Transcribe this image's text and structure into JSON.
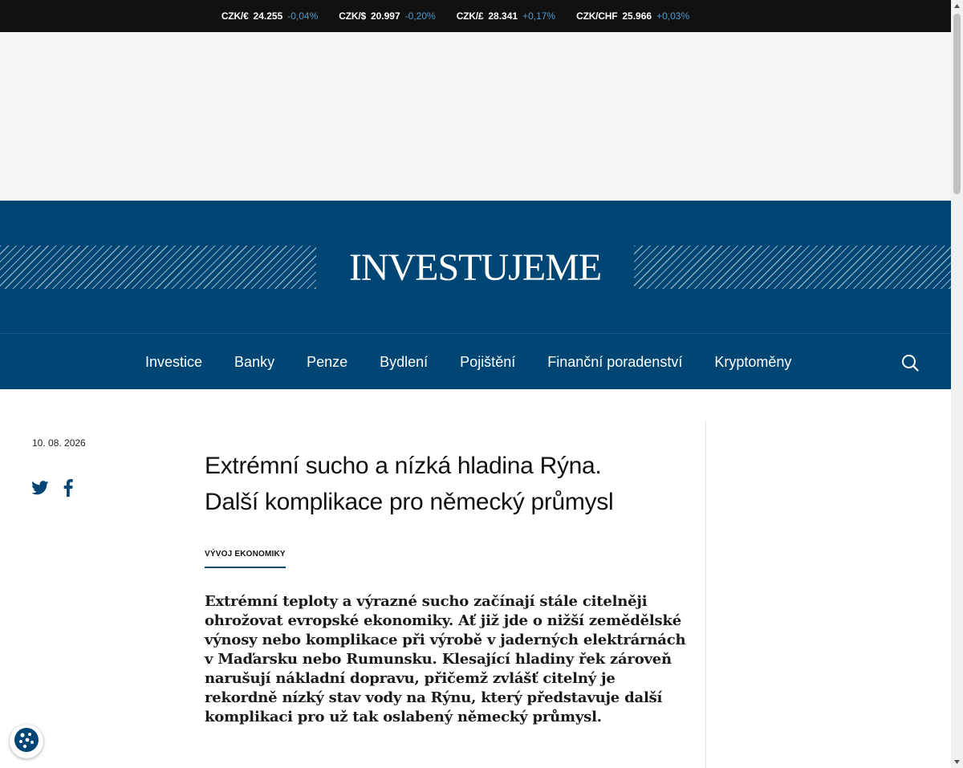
{
  "ticker": [
    {
      "pair": "CZK/€",
      "value": "24.255",
      "change": "-0,04%"
    },
    {
      "pair": "CZK/$",
      "value": "20.997",
      "change": "-0,20%"
    },
    {
      "pair": "CZK/£",
      "value": "28.341",
      "change": "+0,17%"
    },
    {
      "pair": "CZK/CHF",
      "value": "25.966",
      "change": "+0,03%"
    }
  ],
  "header": {
    "logo": "INVESTUJEME",
    "brand_color": "#004674"
  },
  "nav": {
    "items": [
      "Investice",
      "Banky",
      "Penze",
      "Bydlení",
      "Pojištění",
      "Finanční poradenství",
      "Kryptoměny"
    ]
  },
  "article": {
    "date": "10. 08. 2026",
    "title_line1": "Extrémní sucho a nízká hladina Rýna.",
    "title_line2": "Další komplikace pro německý průmysl",
    "category": "VÝVOJ EKONOMIKY",
    "perex": "Extrémní teploty a výrazné sucho začínají stále citelněji ohrožovat evropské ekonomiky. Ať již jde o nižší zemědělské výnosy nebo komplikace při výrobě v jaderných elektrárnách v Maďarsku nebo Rumunsku. Klesající hladiny řek zároveň narušují nákladní dopravu, přičemž zvlášť citelný je rekordně nízký stav vody na Rýnu, který představuje další komplikaci pro už tak oslabený německý průmysl."
  },
  "icons": {
    "share": [
      "twitter-icon",
      "facebook-icon"
    ],
    "search": "search-icon",
    "cookie": "cookie-icon"
  }
}
